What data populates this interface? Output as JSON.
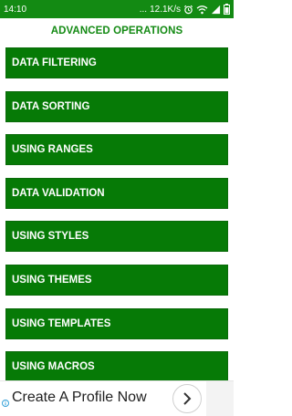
{
  "status_bar": {
    "time": "14:10",
    "more": "...",
    "speed": "12.1K/s",
    "alarm_icon": "alarm-clock-icon",
    "wifi_icon": "wifi-icon",
    "signal_icon": "signal-icon",
    "battery_icon": "battery-icon"
  },
  "page": {
    "title": "ADVANCED OPERATIONS"
  },
  "menu": {
    "items": [
      {
        "label": "DATA FILTERING"
      },
      {
        "label": "DATA SORTING"
      },
      {
        "label": "USING RANGES"
      },
      {
        "label": "DATA VALIDATION"
      },
      {
        "label": "USING STYLES"
      },
      {
        "label": "USING THEMES"
      },
      {
        "label": "USING TEMPLATES"
      },
      {
        "label": "USING MACROS"
      }
    ]
  },
  "ad": {
    "text": "Create A Profile Now",
    "info_icon": "info-icon",
    "next_icon": "chevron-right-icon"
  },
  "colors": {
    "status_bar": "#138a13",
    "button": "#067a06",
    "title": "#138a13"
  }
}
